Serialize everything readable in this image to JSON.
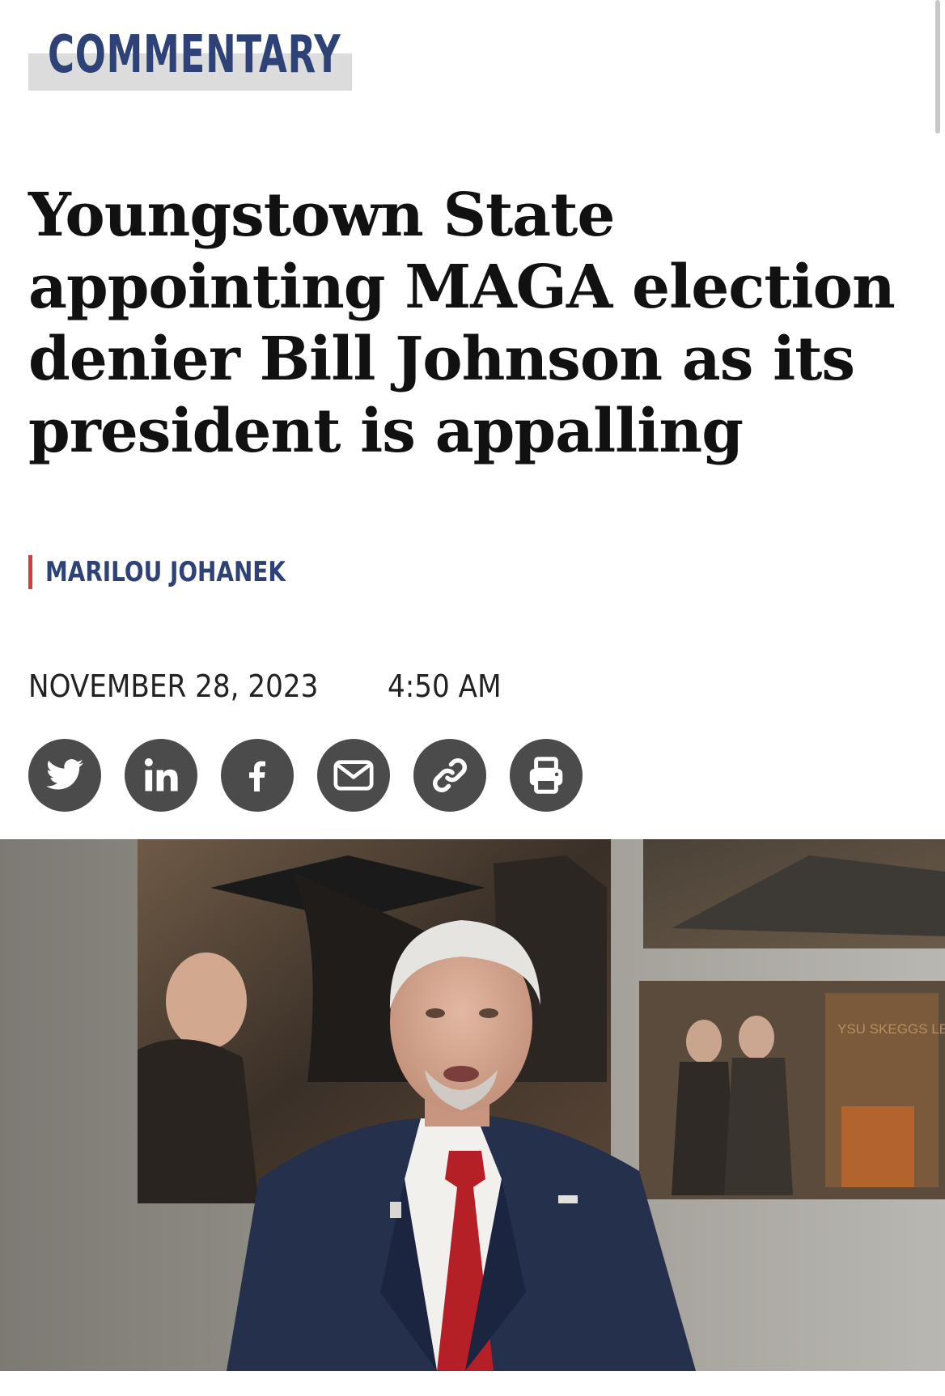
{
  "article": {
    "section": "COMMENTARY",
    "headline": "Youngstown State appointing MAGA election denier Bill Johnson as its president is appalling",
    "author": "MARILOU JOHANEK",
    "date": "NOVEMBER 28, 2023",
    "time": "4:50 AM"
  },
  "share": {
    "icons": [
      "twitter-icon",
      "linkedin-icon",
      "facebook-icon",
      "email-icon",
      "link-icon",
      "print-icon"
    ],
    "icon_color": "#4b4b4b"
  },
  "photo": {
    "poster_text": "YSU SKEGGS LECTURE SERIES"
  },
  "colors": {
    "kicker_text": "#2e4278",
    "kicker_bg": "#dcdcdc",
    "byline_accent": "#d93b3b",
    "headline": "#111111"
  }
}
